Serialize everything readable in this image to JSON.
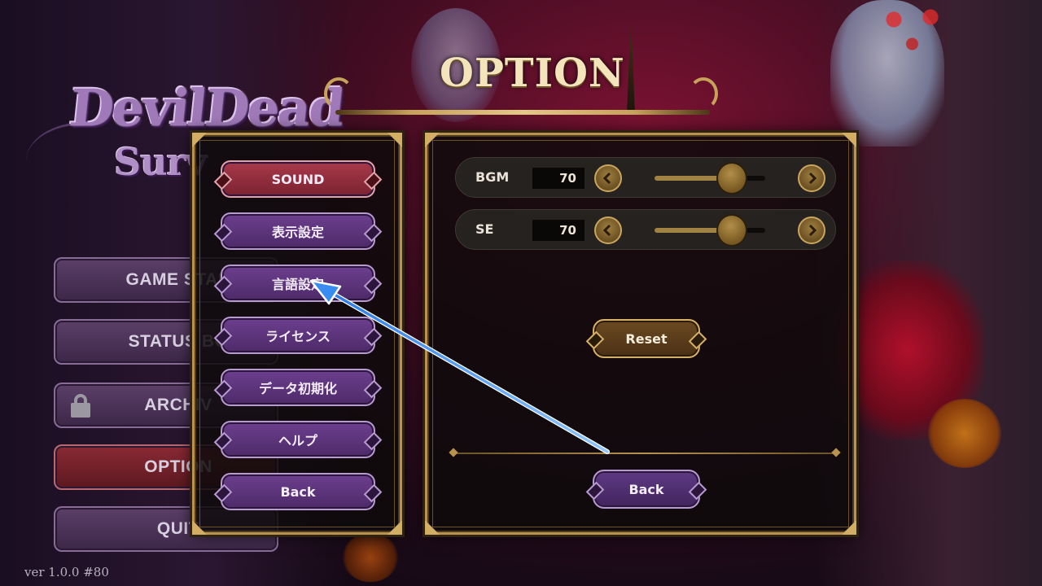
{
  "logo": {
    "line1": "DevilDead",
    "line2": "Surv"
  },
  "main_menu": {
    "items": [
      {
        "label": "GAME STAR"
      },
      {
        "label": "STATUS BO"
      },
      {
        "label": "ARCHIV",
        "locked": true
      },
      {
        "label": "OPTION",
        "active": true
      },
      {
        "label": "QUIT"
      }
    ]
  },
  "version": "ver 1.0.0 #80",
  "option": {
    "title": "OPTION",
    "categories": [
      {
        "label": "SOUND",
        "active": true
      },
      {
        "label": "表示設定"
      },
      {
        "label": "言語設定"
      },
      {
        "label": "ライセンス"
      },
      {
        "label": "データ初期化"
      },
      {
        "label": "ヘルプ"
      },
      {
        "label": "Back"
      }
    ],
    "sound": {
      "bgm": {
        "label": "BGM",
        "value": "70",
        "level": 0.7
      },
      "se": {
        "label": "SE",
        "value": "70",
        "level": 0.7
      }
    },
    "reset_label": "Reset",
    "back_label": "Back"
  },
  "colors": {
    "accent_gold": "#b8924e",
    "active_red": "#a8394a",
    "button_purple": "#6c3f8e",
    "annotation_blue": "#3a8df0"
  },
  "icons": {
    "arrow_left": "chevron-left-icon",
    "arrow_right": "chevron-right-icon",
    "lock": "lock-icon"
  }
}
